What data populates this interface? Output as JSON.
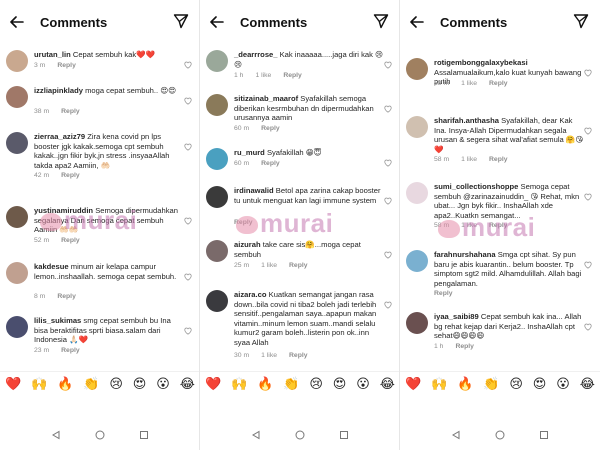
{
  "app": {
    "title": "Comments"
  },
  "panels": [
    {
      "comments": [
        {
          "user": "urutan_lin",
          "text": "Cepat sembuh kak❤️❤️",
          "time": "3 m",
          "likes": "",
          "reply": "Reply",
          "avatar_color": "#c9a88f"
        },
        {
          "user": "izzliapinklady",
          "text": "moga cepat sembuh.. 😍😍",
          "time": "38 m",
          "likes": "",
          "reply": "Reply",
          "avatar_color": "#a07868"
        },
        {
          "user": "zierraa_aziz79",
          "text": "Zira kena covid pn lps booster jgk kakak.semoga cpt sembuh kakak..jgn fikir byk,jn stress .insyaaAllah takda apa2 Aamiin, 🤲🏻",
          "time": "42 m",
          "likes": "",
          "reply": "Reply",
          "avatar_color": "#5a5a6a"
        },
        {
          "user": "yustinamiruddin",
          "text": "Semoga dipermudahkan segalanya Dan semoga cepat sembuh Aamiin 🤲🏻🤲🏻",
          "time": "52 m",
          "likes": "",
          "reply": "Reply",
          "avatar_color": "#6e5a4a"
        },
        {
          "user": "kakdesue",
          "text": "minum air kelapa campur lemon..inshaallah. semoga cepat sembuh.",
          "time": "8 m",
          "likes": "",
          "reply": "Reply",
          "avatar_color": "#c0a090"
        },
        {
          "user": "lilis_sukimas",
          "text": "smg cepat sembuh bu Ina bisa beraktifitas sprti biasa.salam dari Indonesia 🙏🏻❤️",
          "time": "23 m",
          "likes": "",
          "reply": "Reply",
          "avatar_color": "#4a4e6e"
        }
      ]
    },
    {
      "comments": [
        {
          "user": "_dearrrose_",
          "text": "Kak inaaaaa.....jaga diri kak 😢😢",
          "time": "1 h",
          "likes": "1 like",
          "reply": "Reply",
          "avatar_color": "#9aa89a"
        },
        {
          "user": "sitizainab_maarof",
          "text": "Syafakillah semoga diberikan kesrmbuhan dn dipermudahkan urusannya aamin",
          "time": "60 m",
          "likes": "",
          "reply": "Reply",
          "avatar_color": "#8a7a5a"
        },
        {
          "user": "ru_murd",
          "text": "Syafakillah 😁😇",
          "time": "60 m",
          "likes": "",
          "reply": "Reply",
          "avatar_color": "#4aa0c0"
        },
        {
          "user": "irdinawalid",
          "text": "Betol apa zarina cakap booster tu untuk menguat kan lagi immune system",
          "time": "",
          "likes": "",
          "reply": "Reply",
          "avatar_color": "#3a3a3a"
        },
        {
          "user": "aizurah",
          "text": "take care sis🤗...moga cepat sembuh",
          "time": "25 m",
          "likes": "1 like",
          "reply": "Reply",
          "avatar_color": "#7a6a6a"
        },
        {
          "user": "aizara.co",
          "text": "Kuatkan semangat jangan rasa down..bila covid ni tiba2 boleh jadi terlebih sensitif..pengalaman saya..apapun makan vitamin..minum lemon suam..mandi selalu kumur2 garam boleh..listerin pon ok..inn syaa Allah",
          "time": "30 m",
          "likes": "1 like",
          "reply": "Reply",
          "avatar_color": "#3a3a3e"
        }
      ]
    },
    {
      "comments": [
        {
          "user": "rotigembonggalaxybekasi",
          "text": "Assalamualaikum,kalo kuat kunyah bawang putih",
          "time": "58 m",
          "likes": "1 like",
          "reply": "Reply",
          "avatar_color": "#a08060"
        },
        {
          "user": "sharifah.anthasha",
          "text": "Syafakillah, dear Kak Ina. Insya-Allah Dipermudahkan segala urusan & segera sihat wal'afiat semula 🤗😘❤️",
          "time": "58 m",
          "likes": "1 like",
          "reply": "Reply",
          "avatar_color": "#d0c0b0"
        },
        {
          "user": "sumi_collectionshoppe",
          "text": "Semoga cepat sembuh @zarinazainuddin_ 😘 Rehat, mkn ubat... Jgn byk fikir.. InshaAllah xde apa2..Kuatkn semangat...",
          "time": "58 m",
          "likes": "1 like",
          "reply": "Reply",
          "avatar_color": "#e8d8e0"
        },
        {
          "user": "farahnurshahana",
          "text": "Smga cpt sihat. Sy pun baru je abis kuarantin.. belum booster. Tp simptom sgt2 mild. Alhamdulillah. Allah bagi pengalaman.",
          "time": "",
          "likes": "",
          "reply": "Reply",
          "avatar_color": "#7ab0d0"
        },
        {
          "user": "iyaa_saibi89",
          "text": "Cepat sembuh kak ina... Allah bg rehat kejap dari Kerja2.. InshaAllah cpt sehat😄😄😄😄",
          "time": "1 h",
          "likes": "",
          "reply": "Reply",
          "avatar_color": "#6a5050"
        }
      ]
    }
  ],
  "emoji_bar": [
    "❤️",
    "🙌",
    "🔥",
    "👏",
    "😢",
    "😍",
    "😮",
    "😂"
  ],
  "watermark": "murai",
  "colors": {
    "text": "#262626",
    "meta": "#8e8e8e",
    "watermark": "#c478b0"
  },
  "icons": {
    "back": "back-arrow-icon",
    "send": "send-paper-plane-icon",
    "heart": "heart-outline-icon",
    "nav_back": "triangle-back-icon",
    "nav_home": "circle-home-icon",
    "nav_recents": "square-recents-icon"
  }
}
